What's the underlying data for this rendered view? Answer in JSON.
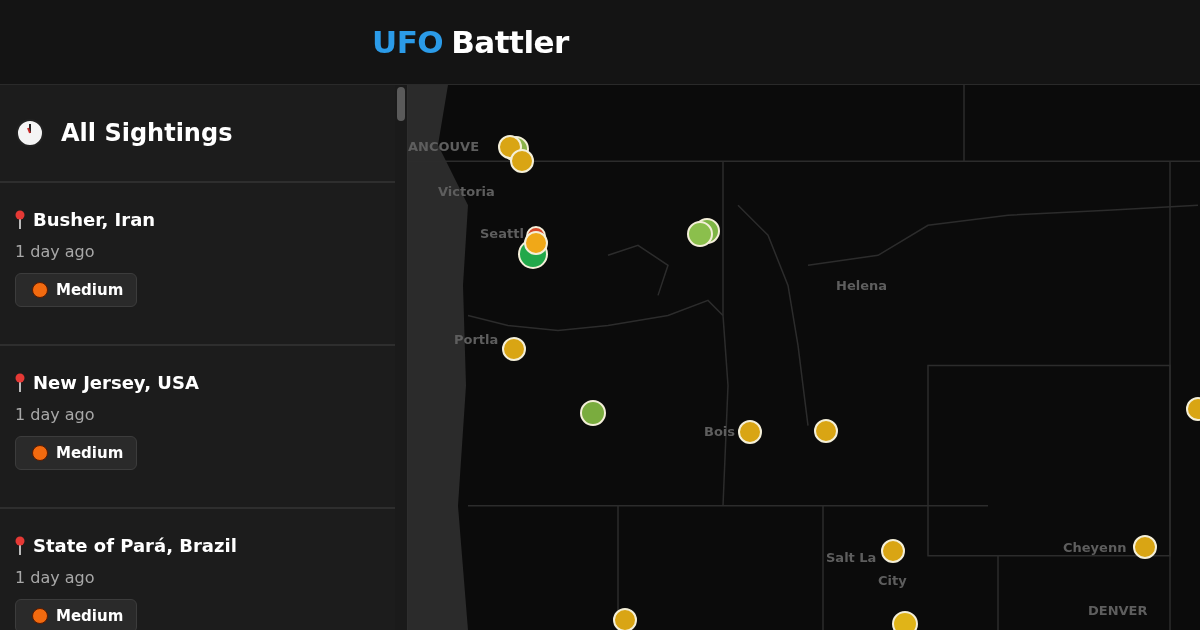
{
  "header": {
    "title_accent": "UFO",
    "title_rest": "Battler"
  },
  "sidebar": {
    "heading": "All Sightings",
    "sightings": [
      {
        "location": "Busher, Iran",
        "time": "1 day ago",
        "severity": {
          "label": "Medium",
          "color": "#f26a0f"
        }
      },
      {
        "location": "New Jersey, USA",
        "time": "1 day ago",
        "severity": {
          "label": "Medium",
          "color": "#f26a0f"
        }
      },
      {
        "location": "State of Pará, Brazil",
        "time": "1 day ago",
        "severity": {
          "label": "Medium",
          "color": "#f26a0f"
        }
      }
    ]
  },
  "map": {
    "places": [
      {
        "name": "ANCOUVE",
        "kind": "city"
      },
      {
        "name": "Victoria",
        "kind": "city"
      },
      {
        "name": "Seattl",
        "kind": "city"
      },
      {
        "name": "Portla",
        "kind": "city"
      },
      {
        "name": "Helena",
        "kind": "city"
      },
      {
        "name": "Bois",
        "kind": "city"
      },
      {
        "name": "Salt La",
        "kind": "city"
      },
      {
        "name": "City",
        "kind": "city"
      },
      {
        "name": "Cheyenn",
        "kind": "city"
      },
      {
        "name": "DENVER",
        "kind": "city"
      }
    ],
    "markers": [
      {
        "color": "#8ab34a"
      },
      {
        "color": "#d9a514"
      },
      {
        "color": "#d9a514"
      },
      {
        "color": "#d84a2a"
      },
      {
        "color": "#22a84a"
      },
      {
        "color": "#f0a818"
      },
      {
        "color": "#7fb545"
      },
      {
        "color": "#8bbf4c"
      },
      {
        "color": "#d9a514"
      },
      {
        "color": "#7aac3e"
      },
      {
        "color": "#d9a514"
      },
      {
        "color": "#d9a514"
      },
      {
        "color": "#d9a514"
      },
      {
        "color": "#d9a514"
      },
      {
        "color": "#d9a514"
      },
      {
        "color": "#d9a514"
      },
      {
        "color": "#e0b418"
      }
    ]
  }
}
